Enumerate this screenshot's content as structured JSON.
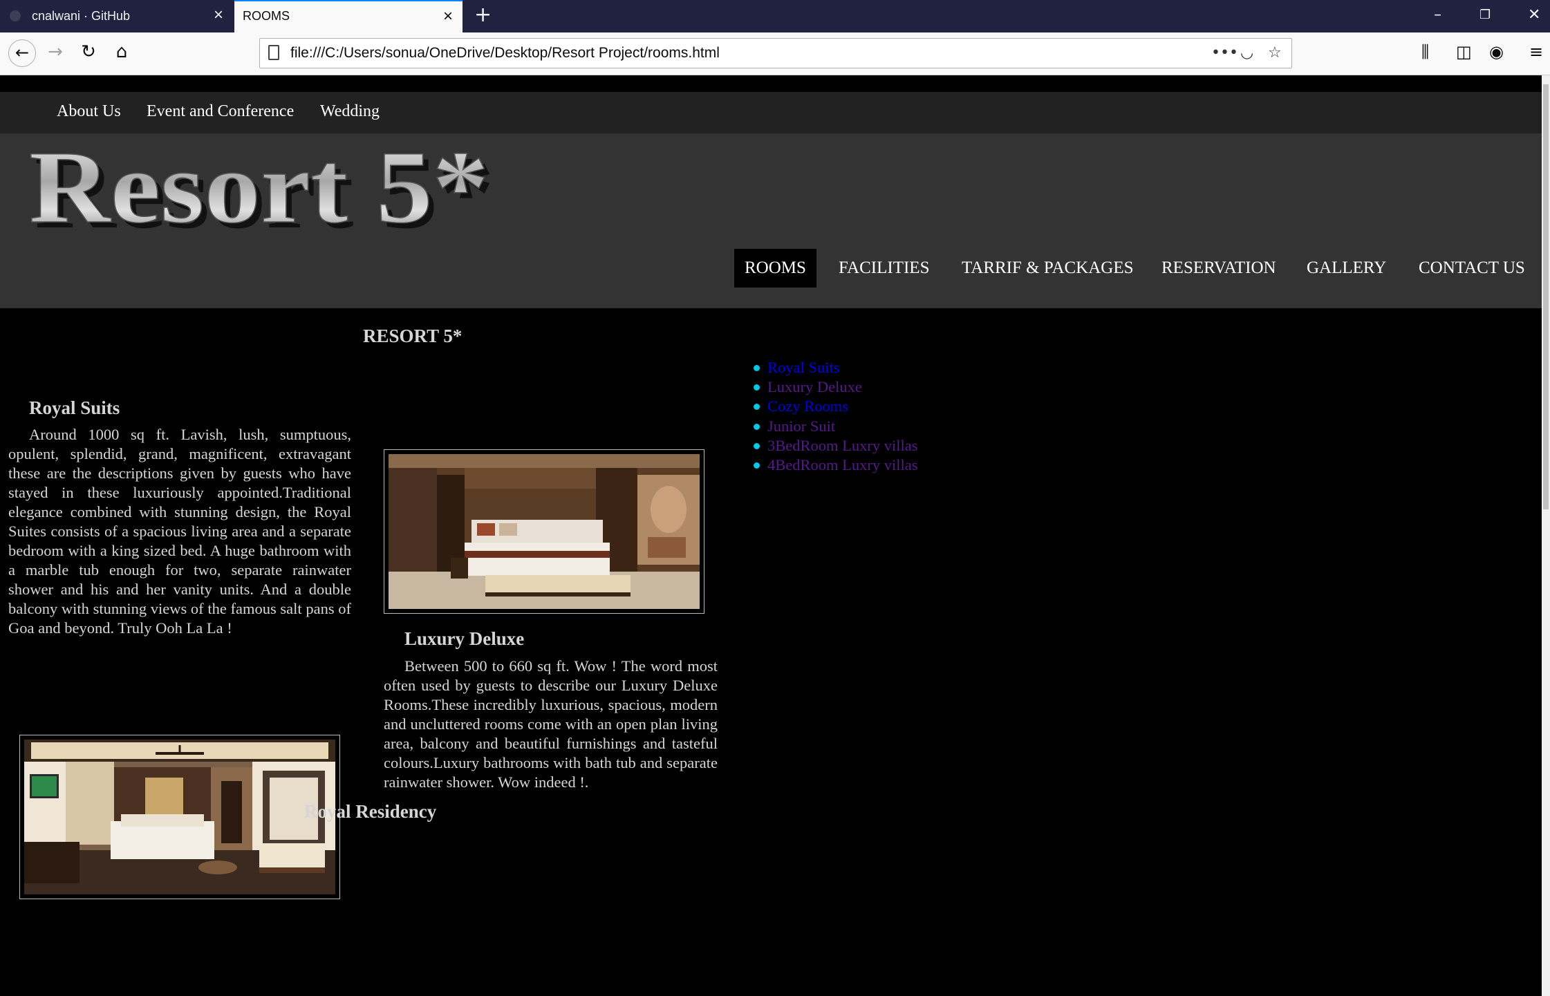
{
  "browser": {
    "tabs": [
      {
        "title": "cnalwani · GitHub",
        "active": false
      },
      {
        "title": "ROOMS",
        "active": true
      }
    ],
    "new_tab_symbol": "+",
    "url": "file:///C:/Users/sonua/OneDrive/Desktop/Resort Project/rooms.html",
    "icons": [
      "back-icon",
      "forward-icon",
      "reload-icon",
      "home-icon",
      "page-icon",
      "more-icon",
      "pocket-icon",
      "bookmark-star-icon",
      "library-icon",
      "sidebar-icon",
      "account-icon",
      "menu-icon",
      "minimize-icon",
      "restore-icon",
      "close-icon"
    ]
  },
  "top_nav": [
    "About Us",
    "Event and Conference",
    "Wedding"
  ],
  "logo_text": "Resort 5*",
  "main_nav": {
    "items": [
      "ROOMS",
      "FACILITIES",
      "TARRIF & PACKAGES",
      "RESERVATION",
      "GALLERY",
      "CONTACT US"
    ],
    "active": "ROOMS"
  },
  "content": {
    "heading": "RESORT 5*",
    "rooms": [
      {
        "title": "Royal Suits",
        "description": "Around 1000 sq ft. Lavish, lush, sumptuous, opulent, splendid, grand, magnificent, extravagant these are the descriptions given by guests who have stayed in these luxuriously appointed.Traditional elegance combined with stunning design, the Royal Suites consists of a spacious living area and a separate bedroom with a king sized bed. A huge bathroom with a marble tub enough for two, separate rainwater shower and his and her vanity units. And a double balcony with stunning views of the famous salt pans of Goa and beyond. Truly Ooh La La !"
      },
      {
        "title": "Luxury Deluxe",
        "description": "Between 500 to 660 sq ft. Wow ! The word most often used by guests to describe our Luxury Deluxe Rooms.These incredibly luxurious, spacious, modern and uncluttered rooms come with an open plan living area, balcony and beautiful furnishings and tasteful colours.Luxury bathrooms with bath tub and separate rainwater shower. Wow indeed !."
      },
      {
        "title": "Royal Residency"
      }
    ],
    "room_links": [
      {
        "label": "Royal Suits",
        "color": "#0000ee"
      },
      {
        "label": "Luxury Deluxe",
        "color": "#551a8b"
      },
      {
        "label": "Cozy Rooms",
        "color": "#0000ee"
      },
      {
        "label": "Junior Suit",
        "color": "#551a8b"
      },
      {
        "label": "3BedRoom Luxry villas",
        "color": "#551a8b"
      },
      {
        "label": "4BedRoom Luxry villas",
        "color": "#551a8b"
      }
    ]
  },
  "colors": {
    "tab_bar": "#202340",
    "top_menu_bg": "#222222",
    "header_bg": "#333333",
    "page_bg": "#000000",
    "bullet": "#00c8e6"
  }
}
